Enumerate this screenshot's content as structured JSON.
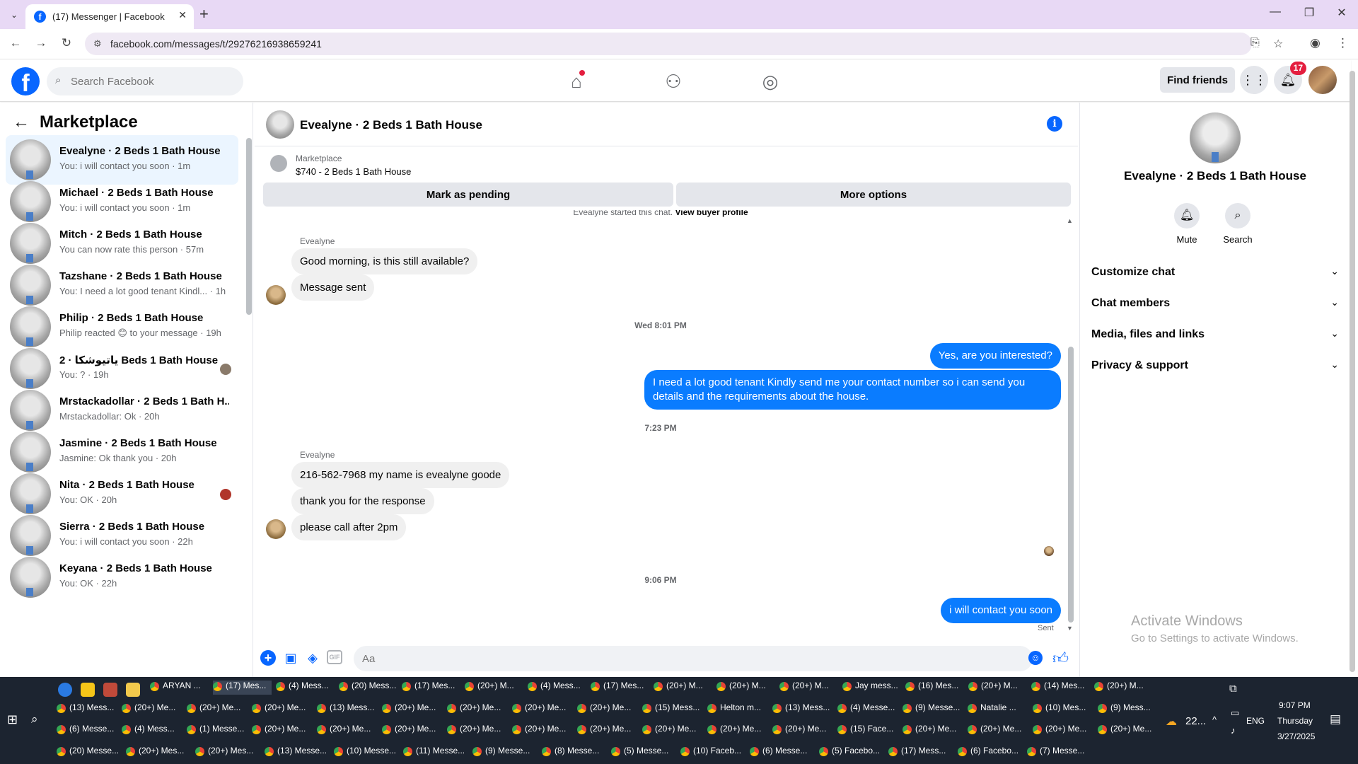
{
  "browser": {
    "tab_title": "(17) Messenger | Facebook",
    "url": "facebook.com/messages/t/29276216938659241"
  },
  "header": {
    "search_placeholder": "Search Facebook",
    "find_friends": "Find friends",
    "notif_count": "17"
  },
  "left": {
    "title": "Marketplace",
    "conversations": [
      {
        "name": "Evealyne · 2 Beds 1 Bath House",
        "preview": "You: i will contact you soon · 1m",
        "active": true
      },
      {
        "name": "Michael · 2 Beds 1 Bath House",
        "preview": "You: i will contact you soon · 1m"
      },
      {
        "name": "Mitch · 2 Beds 1 Bath House",
        "preview": "You can now rate this person · 57m"
      },
      {
        "name": "Tazshane · 2 Beds 1 Bath House",
        "preview": "You: I need a lot good tenant Kindl... · 1h"
      },
      {
        "name": "Philip · 2 Beds 1 Bath House",
        "preview": "Philip reacted 😊 to your message · 19h"
      },
      {
        "name": "یاتیوشکا · 2 Beds 1 Bath House",
        "preview": "You: ? · 19h"
      },
      {
        "name": "Mrstackadollar · 2 Beds 1 Bath H...",
        "preview": "Mrstackadollar: Ok · 20h"
      },
      {
        "name": "Jasmine · 2 Beds 1 Bath House",
        "preview": "Jasmine: Ok thank you · 20h"
      },
      {
        "name": "Nita · 2 Beds 1 Bath House",
        "preview": "You: OK · 20h"
      },
      {
        "name": "Sierra · 2 Beds 1 Bath House",
        "preview": "You: i will contact you soon · 22h"
      },
      {
        "name": "Keyana · 2 Beds 1 Bath House",
        "preview": "You: OK · 22h"
      }
    ]
  },
  "chat": {
    "title": "Evealyne · 2 Beds 1 Bath House",
    "marketplace_label": "Marketplace",
    "listing": "$740 - 2 Beds 1 Bath House",
    "mark_pending": "Mark as pending",
    "more_options": "More options",
    "started_text": "Evealyne started this chat.",
    "view_buyer": "View buyer profile",
    "sender_name": "Evealyne",
    "msg_in_1": "Good morning, is this still available?",
    "msg_in_2": "Message sent",
    "time_1": "Wed 8:01 PM",
    "msg_out_1": "Yes, are you interested?",
    "msg_out_2": "I need a lot good tenant Kindly send me your contact number so i can send you details and the requirements about the house.",
    "time_2": "7:23 PM",
    "msg_in_3": "216-562-7968 my name is evealyne goode",
    "msg_in_4": "thank you for the response",
    "msg_in_5": "please call after 2pm",
    "time_3": "9:06 PM",
    "msg_out_3": "i will contact you soon",
    "sent_label": "Sent",
    "composer_placeholder": "Aa",
    "gif_label": "GIF"
  },
  "right": {
    "name": "Evealyne · 2 Beds 1 Bath House",
    "mute": "Mute",
    "search": "Search",
    "sections": [
      "Customize chat",
      "Chat members",
      "Media, files and links",
      "Privacy & support"
    ],
    "activate_1": "Activate Windows",
    "activate_2": "Go to Settings to activate Windows."
  },
  "taskbar": {
    "rows": [
      [
        "ARYAN ...",
        "(17) Mes...",
        "(4) Mess...",
        "(20) Mess...",
        "(17) Mes...",
        "(20+) M...",
        "(4) Mess...",
        "(17) Mes...",
        "(20+) M...",
        "(20+) M...",
        "(20+) M...",
        "Jay mess...",
        "(16) Mes...",
        "(20+) M...",
        "(14) Mes...",
        "(20+) M..."
      ],
      [
        "(13) Mess...",
        "(20+) Me...",
        "(20+) Me...",
        "(20+) Me...",
        "(13) Mess...",
        "(20+) Me...",
        "(20+) Me...",
        "(20+) Me...",
        "(20+) Me...",
        "(15) Mess...",
        "Helton m...",
        "(13) Mess...",
        "(4) Messe...",
        "(9) Messe...",
        "Natalie ...",
        "(10) Mes...",
        "(9) Mess..."
      ],
      [
        "(6) Messe...",
        "(4) Mess...",
        "(1) Messe...",
        "(20+) Me...",
        "(20+) Me...",
        "(20+) Me...",
        "(20+) Me...",
        "(20+) Me...",
        "(20+) Me...",
        "(20+) Me...",
        "(20+) Me...",
        "(20+) Me...",
        "(15) Face...",
        "(20+) Me...",
        "(20+) Me...",
        "(20+) Me...",
        "(20+) Me..."
      ],
      [
        "(20) Messe...",
        "(20+) Mes...",
        "(20+) Mes...",
        "(13) Messe...",
        "(10) Messe...",
        "(11) Messe...",
        "(9) Messe...",
        "(8) Messe...",
        "(5) Messe...",
        "(10) Faceb...",
        "(6) Messe...",
        "(5) Facebo...",
        "(17) Mess...",
        "(6) Facebo...",
        "(7) Messe..."
      ]
    ],
    "temp": "22...",
    "lang": "ENG",
    "time": "9:07 PM",
    "day": "Thursday",
    "date": "3/27/2025"
  }
}
